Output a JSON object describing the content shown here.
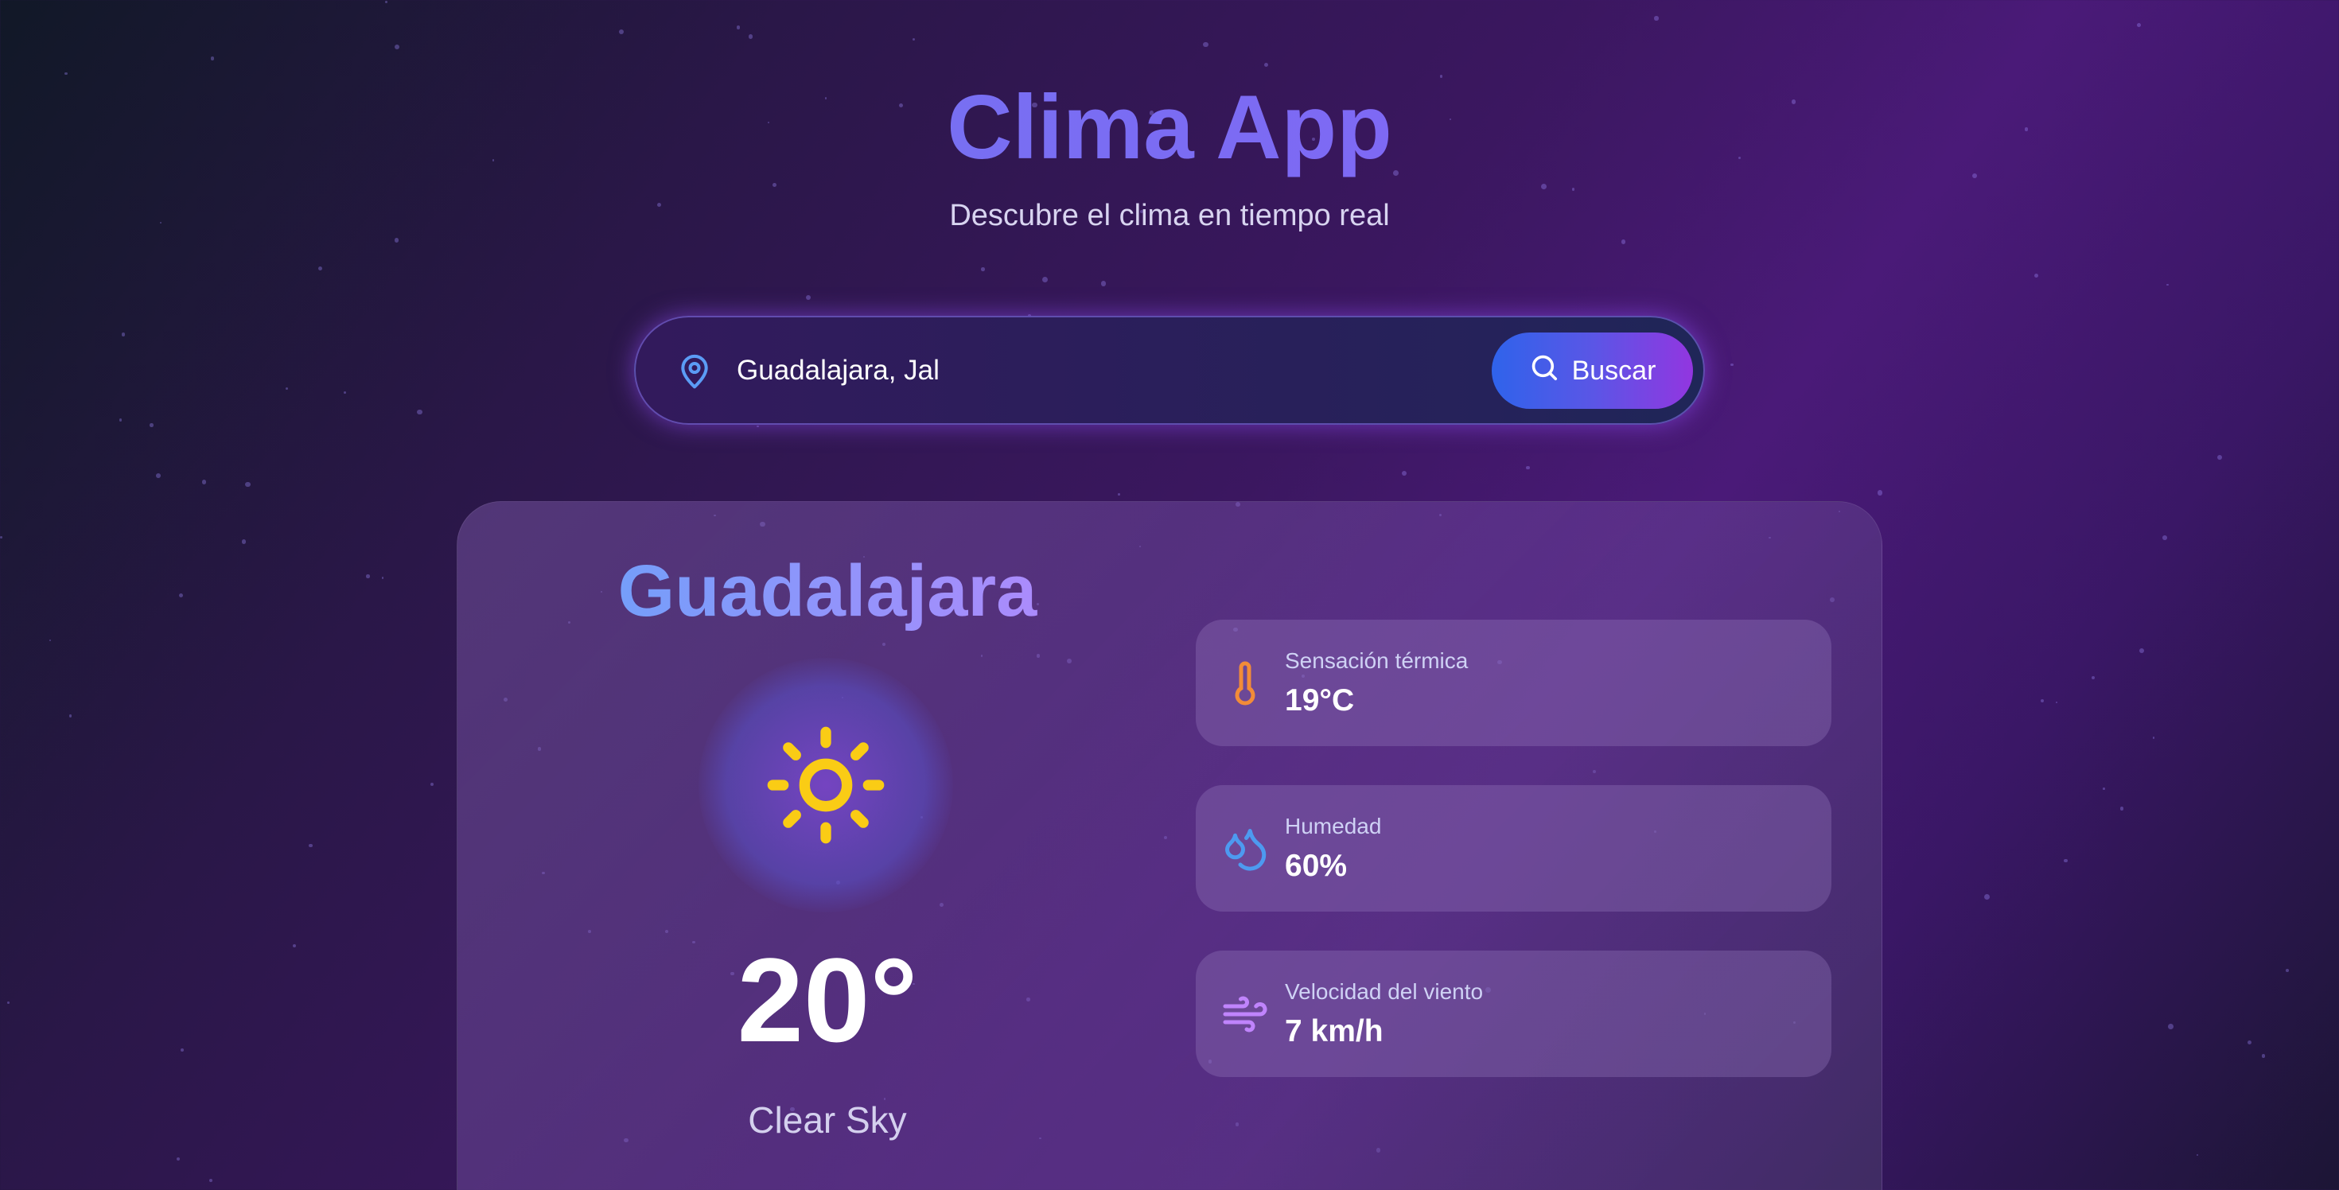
{
  "header": {
    "title": "Clima App",
    "subtitle": "Descubre el clima en tiempo real"
  },
  "search": {
    "value": "Guadalajara, Jal",
    "button_label": "Buscar",
    "icon": "map-pin-icon",
    "button_icon": "search-icon"
  },
  "weather": {
    "city": "Guadalajara",
    "icon": "sun-icon",
    "temperature": "20°",
    "description": "Clear Sky",
    "stats": [
      {
        "label": "Sensación térmica",
        "value": "19°C",
        "icon": "thermometer-icon",
        "color": "#f28c38"
      },
      {
        "label": "Humedad",
        "value": "60%",
        "icon": "droplets-icon",
        "color": "#4d9af0"
      },
      {
        "label": "Velocidad del viento",
        "value": "7 km/h",
        "icon": "wind-icon",
        "color": "#c084fc"
      }
    ]
  },
  "colors": {
    "accent_blue": "#2f63eb",
    "accent_purple": "#9236e0",
    "sun": "#facc15"
  }
}
